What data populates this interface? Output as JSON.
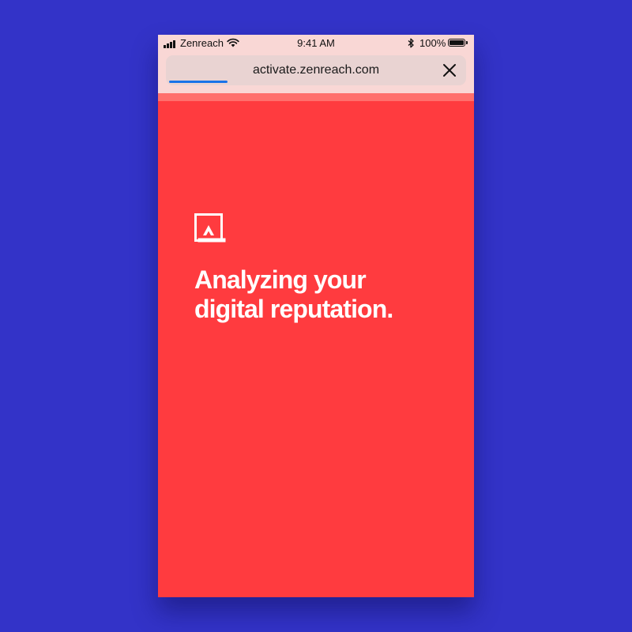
{
  "status_bar": {
    "carrier": "Zenreach",
    "time": "9:41 AM",
    "battery_percent": "100%",
    "icons": [
      "signal-icon",
      "wifi-icon",
      "bluetooth-icon",
      "battery-icon"
    ]
  },
  "browser": {
    "url": "activate.zenreach.com",
    "close_icon": "close-icon",
    "load_progress": 0.2
  },
  "page": {
    "logo_icon": "zenreach-logo-icon",
    "headline_line1": "Analyzing your",
    "headline_line2": "digital reputation."
  },
  "colors": {
    "background": "#3333c8",
    "page_red": "#ff3b3f",
    "chrome_pink": "#f9d7d5",
    "progress_blue": "#1a73e8",
    "text_white": "#ffffff"
  }
}
